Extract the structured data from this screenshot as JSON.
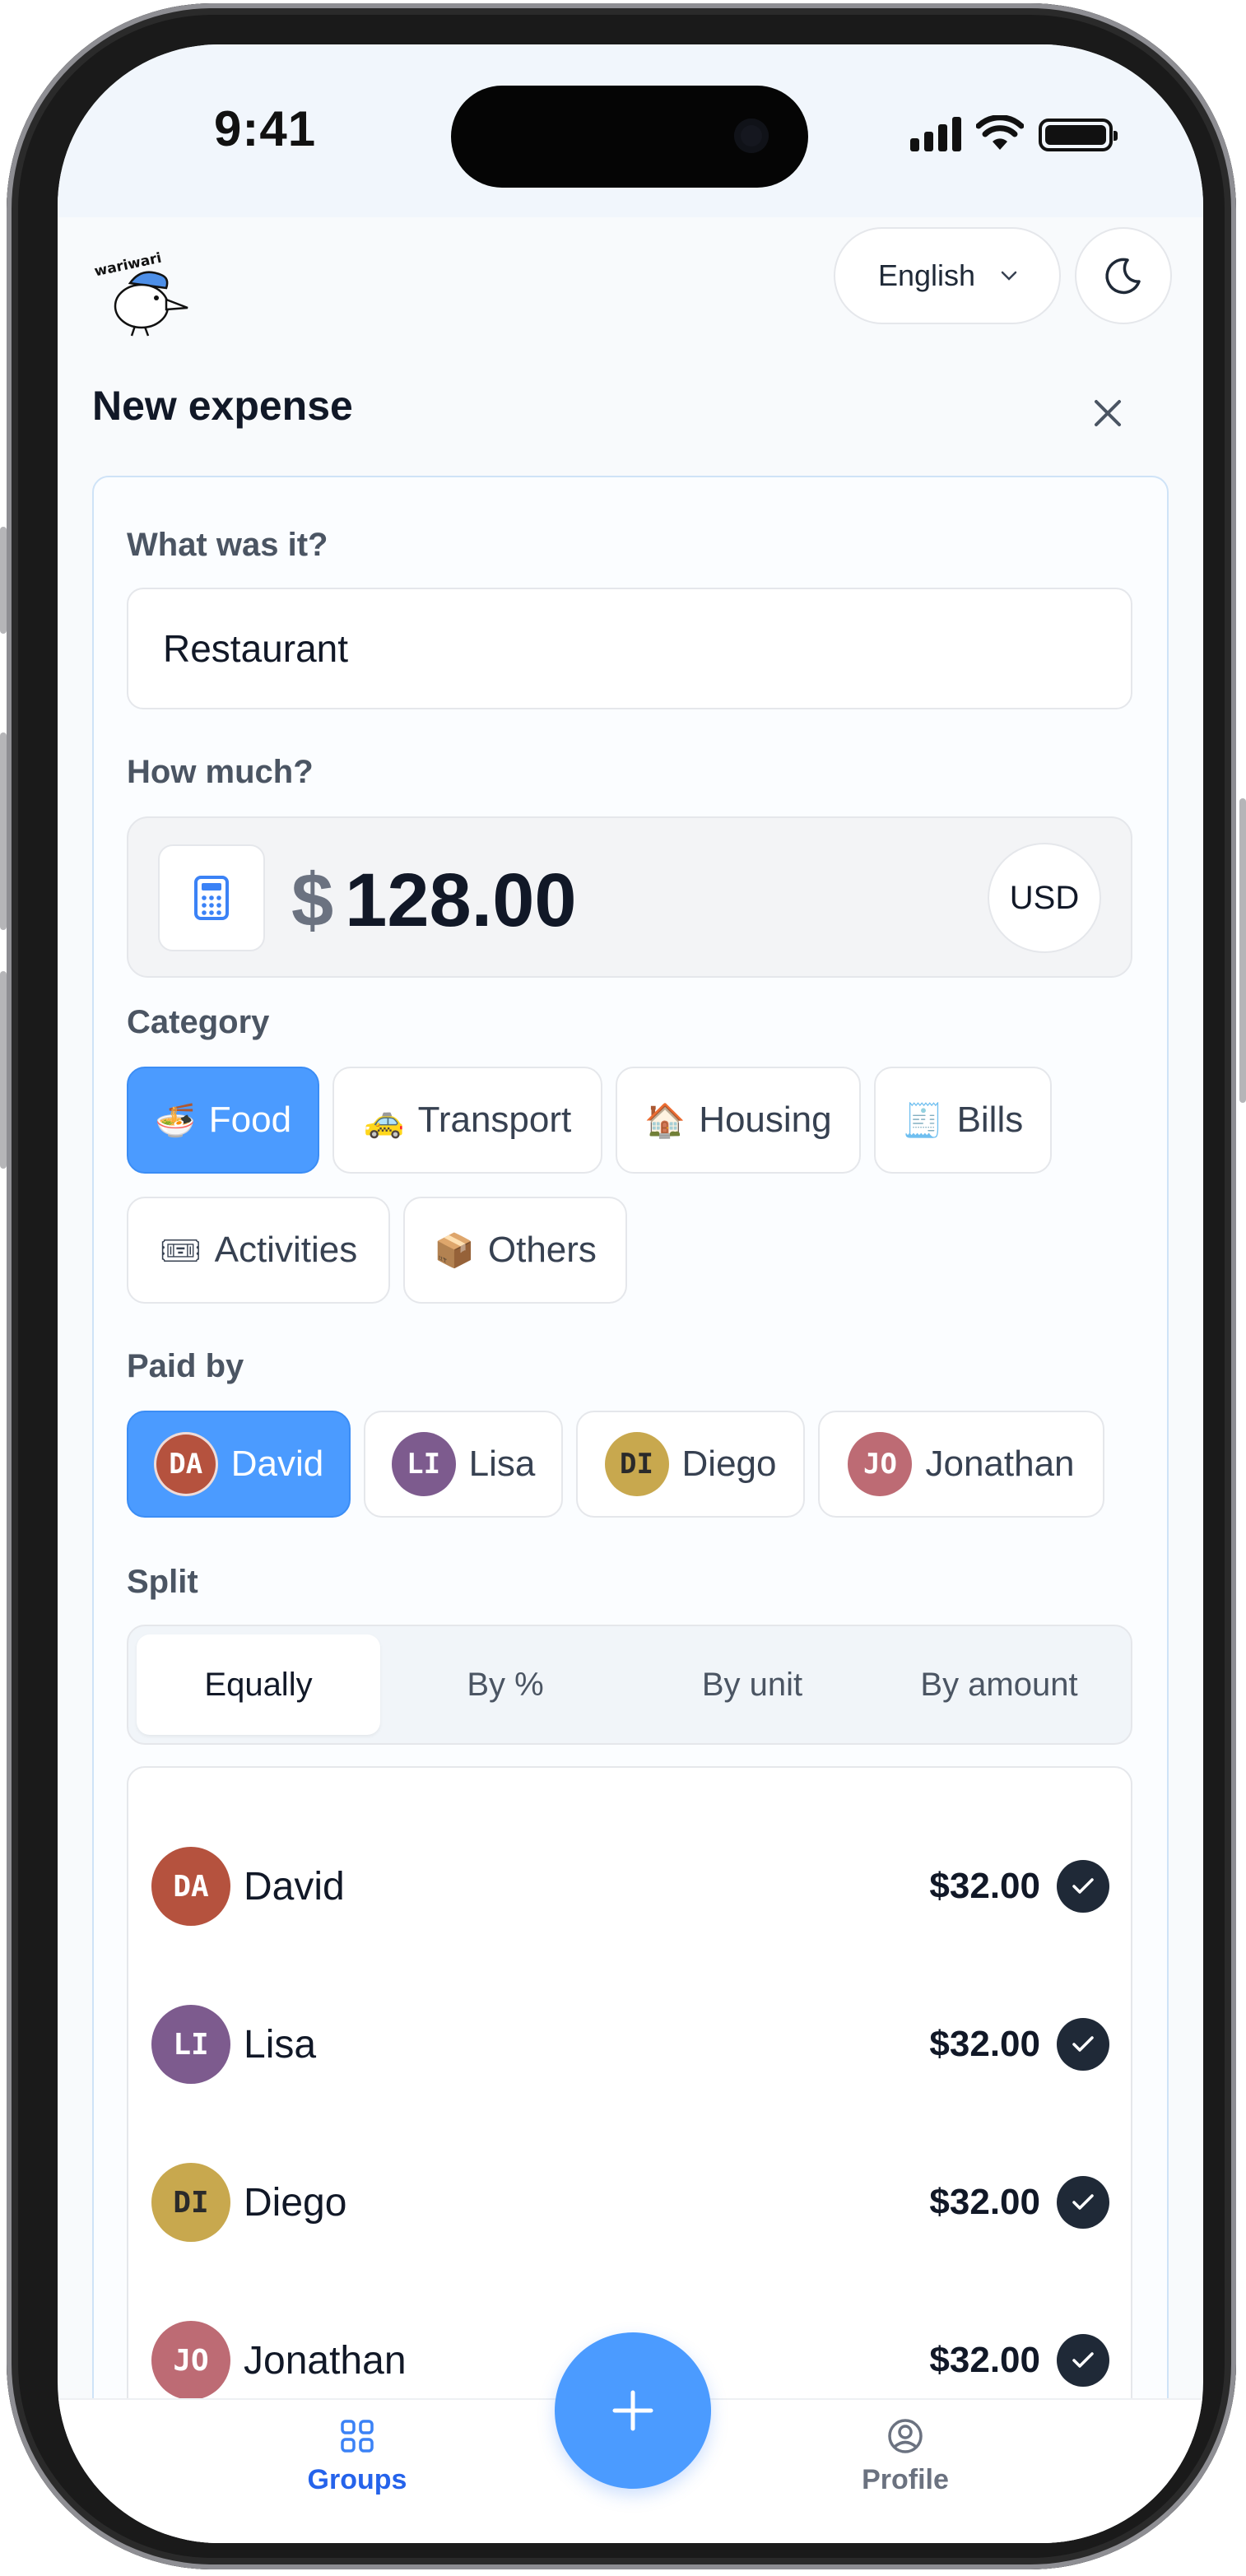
{
  "status_bar": {
    "time": "9:41"
  },
  "header": {
    "language": "English"
  },
  "page": {
    "title": "New expense"
  },
  "form": {
    "what_label": "What was it?",
    "what_value": "Restaurant",
    "how_much_label": "How much?",
    "currency_symbol": "$",
    "amount": "128.00",
    "currency_code": "USD"
  },
  "category": {
    "label": "Category",
    "items": [
      {
        "emoji": "🍜",
        "label": "Food",
        "selected": true
      },
      {
        "emoji": "🚕",
        "label": "Transport",
        "selected": false
      },
      {
        "emoji": "🏠",
        "label": "Housing",
        "selected": false
      },
      {
        "emoji": "🧾",
        "label": "Bills",
        "selected": false
      },
      {
        "emoji": "🎟",
        "label": "Activities",
        "selected": false
      },
      {
        "emoji": "📦",
        "label": "Others",
        "selected": false
      }
    ]
  },
  "paid_by": {
    "label": "Paid by",
    "members": [
      {
        "initials": "DA",
        "name": "David",
        "selected": true
      },
      {
        "initials": "LI",
        "name": "Lisa",
        "selected": false
      },
      {
        "initials": "DI",
        "name": "Diego",
        "selected": false
      },
      {
        "initials": "JO",
        "name": "Jonathan",
        "selected": false
      }
    ]
  },
  "split": {
    "label": "Split",
    "options": [
      "Equally",
      "By %",
      "By unit",
      "By amount"
    ],
    "selected": "Equally",
    "rows": [
      {
        "initials": "DA",
        "name": "David",
        "amount": "$32.00",
        "checked": true
      },
      {
        "initials": "LI",
        "name": "Lisa",
        "amount": "$32.00",
        "checked": true
      },
      {
        "initials": "DI",
        "name": "Diego",
        "amount": "$32.00",
        "checked": true
      },
      {
        "initials": "JO",
        "name": "Jonathan",
        "amount": "$32.00",
        "checked": true
      }
    ]
  },
  "tab_bar": {
    "groups_label": "Groups",
    "profile_label": "Profile"
  },
  "colors": {
    "accent": "#4b9bff",
    "text": "#111827",
    "muted": "#4b5563"
  }
}
